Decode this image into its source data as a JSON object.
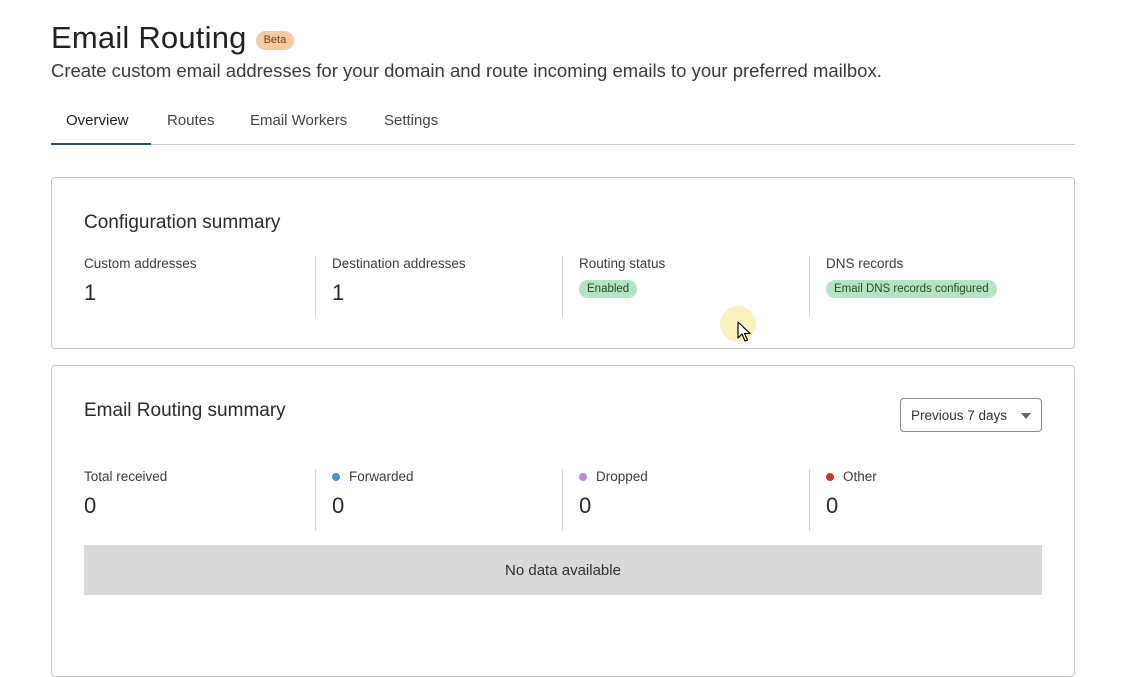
{
  "header": {
    "title": "Email Routing",
    "badge": "Beta",
    "subtitle": "Create custom email addresses for your domain and route incoming emails to your preferred mailbox."
  },
  "tabs": [
    {
      "label": "Overview",
      "active": true
    },
    {
      "label": "Routes",
      "active": false
    },
    {
      "label": "Email Workers",
      "active": false
    },
    {
      "label": "Settings",
      "active": false
    }
  ],
  "config_summary": {
    "title": "Configuration summary",
    "custom_addresses": {
      "label": "Custom addresses",
      "value": "1"
    },
    "destination_addresses": {
      "label": "Destination addresses",
      "value": "1"
    },
    "routing_status": {
      "label": "Routing status",
      "badge": "Enabled"
    },
    "dns_records": {
      "label": "DNS records",
      "badge": "Email DNS records configured"
    }
  },
  "routing_summary": {
    "title": "Email Routing summary",
    "period": "Previous 7 days",
    "total_received": {
      "label": "Total received",
      "value": "0"
    },
    "forwarded": {
      "label": "Forwarded",
      "value": "0",
      "color": "#4a90d9"
    },
    "dropped": {
      "label": "Dropped",
      "value": "0",
      "color": "#c084d8"
    },
    "other": {
      "label": "Other",
      "value": "0",
      "color": "#d32f2f"
    },
    "empty_message": "No data available"
  },
  "colors": {
    "accent": "#2c4a7a",
    "badge_beta_bg": "#f6c9a1",
    "status_pill_bg": "#b4e4c4",
    "no_data_bg": "#d9d9d9"
  }
}
